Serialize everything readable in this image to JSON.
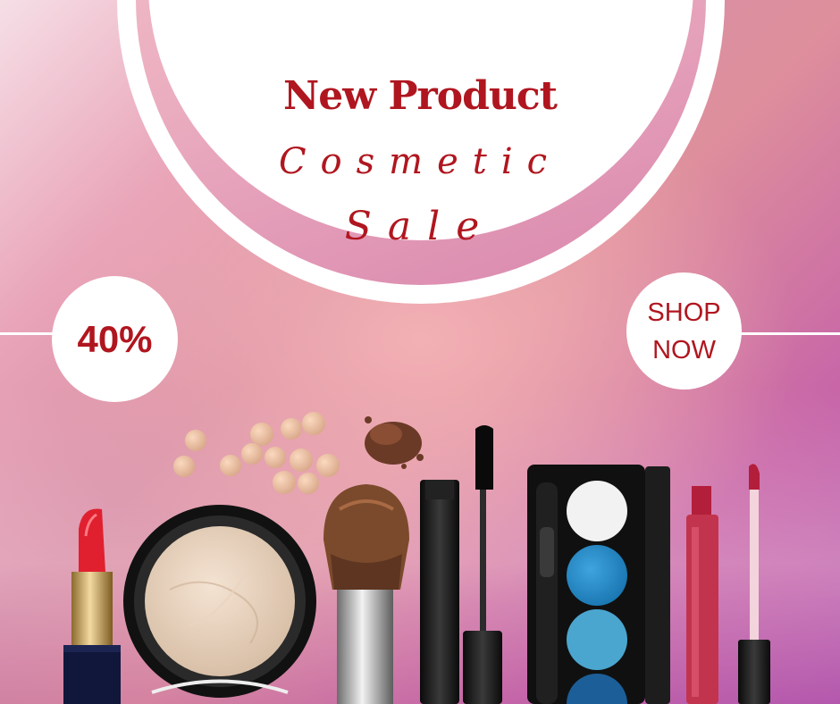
{
  "banner": {
    "title_line1": "New Product",
    "title_line2": "Cosmetic",
    "title_line3": "Sale",
    "discount": "40%",
    "cta_line1": "SHOP",
    "cta_line2": "NOW"
  },
  "colors": {
    "accent": "#b0161f",
    "white": "#ffffff",
    "background_gradient": [
      "#f6dfe6",
      "#de8f9c",
      "#b357ae"
    ]
  },
  "products": [
    "lipstick-icon",
    "compact-powder-icon",
    "beauty-pearls-icon",
    "loose-powder-icon",
    "makeup-brush-icon",
    "mascara-icon",
    "eyeshadow-palette-icon",
    "lip-gloss-icon"
  ]
}
